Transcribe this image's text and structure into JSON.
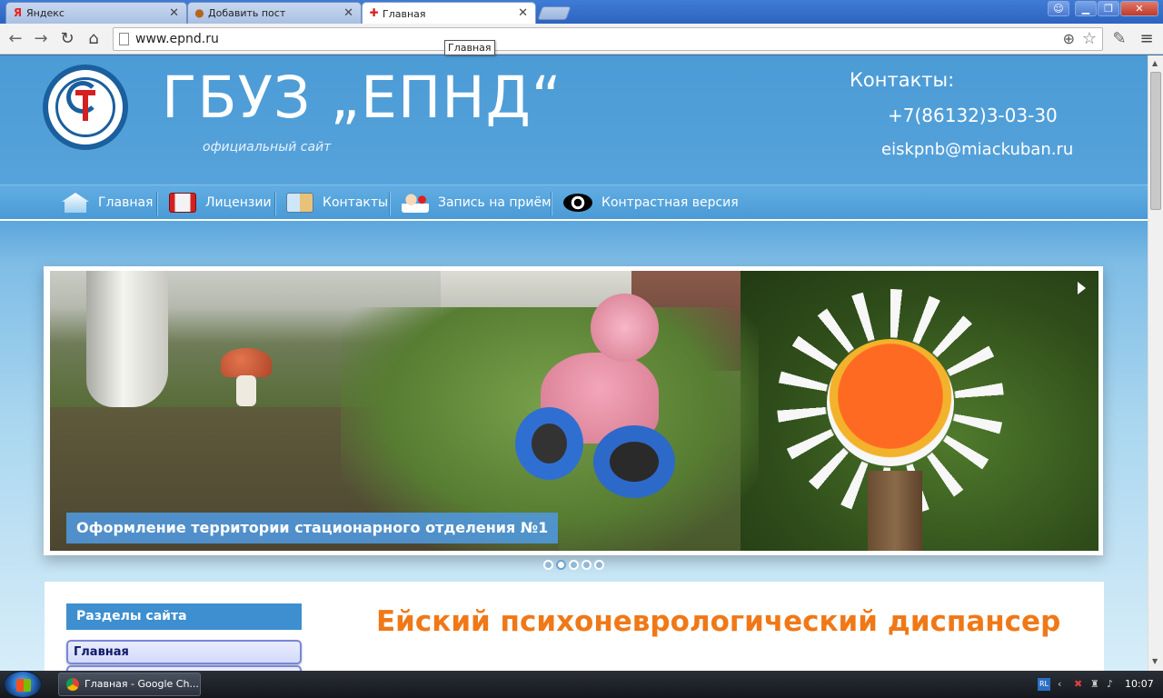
{
  "browser": {
    "tabs": [
      {
        "label": "Яндекс",
        "favicon": "Я",
        "favicon_color": "#e8231f"
      },
      {
        "label": "Добавить пост",
        "favicon": "●",
        "favicon_color": "#b5651d"
      },
      {
        "label": "Главная",
        "favicon": "✚",
        "favicon_color": "#d42020"
      }
    ],
    "url": "www.epnd.ru",
    "tooltip": "Главная",
    "window_controls": [
      "user-icon",
      "minimize-icon",
      "restore-icon",
      "close-icon"
    ]
  },
  "header": {
    "title": "ГБУЗ „ЕПНД“",
    "subtitle": "официальный сайт",
    "contacts_heading": "Контакты:",
    "phone": "+7(86132)3-03-30",
    "email": "eiskpnb@miackuban.ru"
  },
  "menu": {
    "items": [
      {
        "label": "Главная",
        "icon": "home-icon"
      },
      {
        "label": "Лицензии",
        "icon": "certificate-icon"
      },
      {
        "label": "Контакты",
        "icon": "contacts-card-icon"
      },
      {
        "label": "Запись на приём",
        "icon": "doctor-appointment-icon"
      },
      {
        "label": "Контрастная версия",
        "icon": "eye-icon"
      }
    ]
  },
  "slider": {
    "caption": "Оформление территории стационарного отделения №1",
    "slide_count": 5,
    "active_slide": 2
  },
  "sidebar": {
    "heading": "Разделы сайта",
    "items": [
      "Главная"
    ]
  },
  "main": {
    "heading": "Ейский психоневрологический диспансер"
  },
  "taskbar": {
    "window_label": "Главная - Google Ch...",
    "lang": "RL",
    "clock": "10:07"
  },
  "colors": {
    "accent_blue": "#4a9ad6",
    "heading_orange": "#f07817",
    "sidebar_head": "#3d8fd0"
  }
}
